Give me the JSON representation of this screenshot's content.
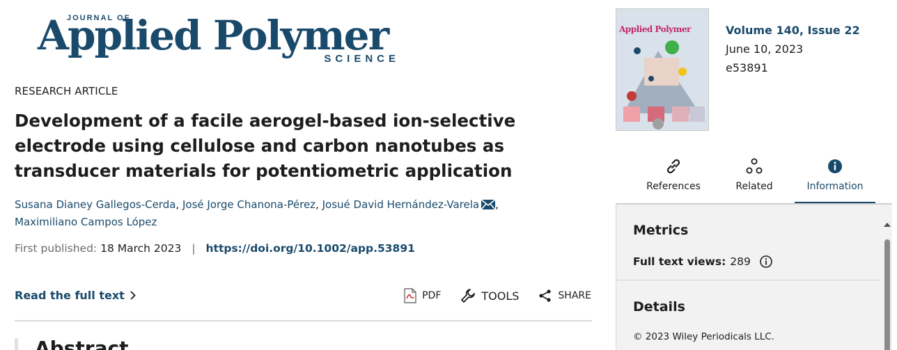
{
  "journal": {
    "logo_top": "JOURNAL OF",
    "logo_main": "Applied Polymer",
    "logo_bottom": "SCIENCE"
  },
  "article": {
    "type": "RESEARCH ARTICLE",
    "title": "Development of a facile aerogel-based ion-selective electrode using cellulose and carbon nanotubes as transducer materials for potentiometric application",
    "authors": [
      "Susana Dianey Gallegos-Cerda",
      "José Jorge Chanona-Pérez",
      "Josué David Hernández-Varela",
      "Maximiliano Campos López"
    ],
    "first_published_label": "First published:",
    "first_published_date": "18 March 2023",
    "doi": "https://doi.org/10.1002/app.53891"
  },
  "actions": {
    "read_full_text": "Read the full text",
    "pdf": "PDF",
    "tools": "TOOLS",
    "share": "SHARE"
  },
  "abstract_heading": "Abstract",
  "issue": {
    "cover_title": "Applied Polymer",
    "volume_issue": "Volume 140, Issue 22",
    "date": "June 10, 2023",
    "article_number": "e53891"
  },
  "tabs": [
    {
      "label": "References",
      "icon": "link-icon"
    },
    {
      "label": "Related",
      "icon": "related-icon"
    },
    {
      "label": "Information",
      "icon": "info-icon"
    }
  ],
  "info_panel": {
    "metrics_heading": "Metrics",
    "full_text_views_label": "Full text views:",
    "full_text_views_value": "289",
    "details_heading": "Details",
    "copyright": "© 2023 Wiley Periodicals LLC."
  },
  "colors": {
    "brand": "#1a4a6b",
    "text": "#1c1d1e",
    "panel_bg": "#f2f2f2"
  }
}
